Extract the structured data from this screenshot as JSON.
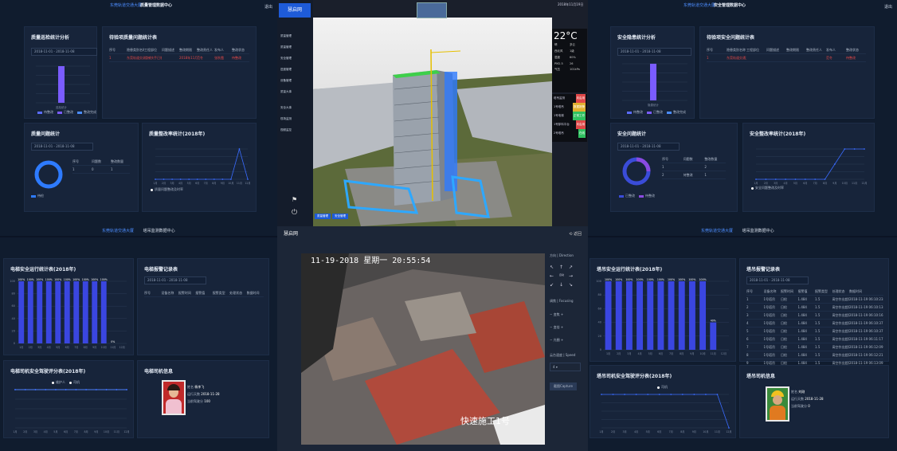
{
  "q1": {
    "t1": "东莞轨道交通大厦",
    "t2": "质量管理数据中心",
    "exit": "退出",
    "p1": {
      "title": "质量巡检统计分析",
      "date_from": "2018-11-01",
      "date_to": "2018-11-08",
      "legend": [
        "待整改",
        "已整改",
        "整改完成"
      ]
    },
    "p2": {
      "title": "待验项质量问题统计表",
      "headers": [
        "序号",
        "隐患类别名称",
        "工程部位",
        "问题描述",
        "整改期限",
        "整改责任人",
        "发布人",
        "整改状态"
      ],
      "row": [
        "1",
        "东莞轨道交通大厦",
        "楼梯扶手已装1/1",
        "",
        "2018年11月8日",
        "范冬",
        "张秋霞",
        "待整改"
      ]
    },
    "p3": {
      "title": "质量问题统计",
      "date_from": "2018-11-01",
      "date_to": "2018-11-08",
      "headers": [
        "序号",
        "问题数",
        "整改数量"
      ],
      "row": [
        "1",
        "0",
        "1"
      ],
      "legend": "待检"
    },
    "p4": {
      "title": "质量整改率统计(2018年)",
      "legend": "质量问题整改及时率"
    },
    "nav_a": "东莞轨道交通大厦",
    "nav_b": "塔吊监测数据中心"
  },
  "q2": {
    "t1": "东莞轨道交通大厦",
    "t2": "安全管理数据中心",
    "exit": "退出",
    "p1": {
      "title": "安全隐患统计分析",
      "date_from": "2018-11-01",
      "date_to": "2018-11-08",
      "legend": [
        "待整改",
        "已整改",
        "整改完成"
      ]
    },
    "p2": {
      "title": "待验项安全问题统计表",
      "headers": [
        "序号",
        "隐患类别名称",
        "工程部位",
        "问题描述",
        "整改期限",
        "整改责任人",
        "发布人",
        "整改状态"
      ],
      "row": [
        "1",
        "东莞轨道交通大厦",
        "",
        "",
        "",
        "",
        "范冬",
        "待整改"
      ]
    },
    "p3": {
      "title": "安全问题统计",
      "date_from": "2018-11-01",
      "date_to": "2018-11-08",
      "headers": [
        "序号",
        "问题数",
        "整改数量"
      ],
      "rows": [
        [
          "1",
          "",
          "2"
        ],
        [
          "2",
          "待整改",
          "1"
        ]
      ],
      "legend": [
        "已整改",
        "待整改"
      ]
    },
    "p4": {
      "title": "安全整改率统计(2018年)",
      "legend": "安全问题整改及时率"
    },
    "nav_a": "东莞轨道交通大厦",
    "nav_b": "塔吊监测数据中心"
  },
  "center": {
    "logo": "慧启网",
    "date_label": "2018年11月19日",
    "menu": [
      "质量管理",
      "质量管理",
      "安全管理",
      "进度管理",
      "设备管理",
      "质量大事",
      "安全大事",
      "现场监测",
      "视频监控"
    ],
    "weather": {
      "temp": "22°C",
      "items": [
        "晴",
        "多云",
        "西北风",
        "1级",
        "湿度",
        "60%",
        "PM2.5",
        "26",
        "气压",
        "101kPa"
      ]
    },
    "status": [
      {
        "label": "塔吊监测",
        "value": "未启用",
        "color": "#e04848"
      },
      {
        "label": "1号塔吊",
        "value": "数据报警",
        "color": "#e0b030"
      },
      {
        "label": "1号电梯",
        "value": "正常工作",
        "color": "#30c060"
      },
      {
        "label": "1号卸料平台",
        "value": "未启用",
        "color": "#e04848"
      },
      {
        "label": "2号塔吊",
        "value": "在线",
        "color": "#30c060"
      }
    ],
    "bottom_tabs": [
      "质量管理",
      "安全管理"
    ]
  },
  "video": {
    "logo": "慧启网",
    "back": "返回",
    "timestamp": "11-19-2018 星期一 20:55:54",
    "caption": "快速施工1号",
    "direction": "方向 | Direction",
    "focusing": "调焦 | Focusing",
    "speed": "云台速度 | Speed",
    "speed_value": "4",
    "capture": "截图Capture",
    "zoom_labels": [
      "变焦",
      "变倍",
      "光圈"
    ]
  },
  "q3": {
    "p1": {
      "title": "电梯安全运行统计表(2018年)",
      "yticks": [
        "100",
        "80",
        "60",
        "40",
        "20",
        "0"
      ]
    },
    "p2": {
      "title": "电梯报警记录表",
      "date_from": "2018-11-01",
      "date_to": "2018-11-08",
      "headers": [
        "序号",
        "设备名称",
        "报警时间",
        "报警值",
        "报警类型",
        "处理状态",
        "数据时间"
      ]
    },
    "p3": {
      "title": "电梯司机安全驾驶评分表(2018年)",
      "legend": [
        "维护人",
        "司机"
      ]
    },
    "p4": {
      "title": "电梯司机信息",
      "name_label": "姓名",
      "name": "杨李飞",
      "work_label": "运行天数",
      "work": "2018-11-28",
      "score_label": "当前驾驶分",
      "score": "100"
    }
  },
  "q4": {
    "p1": {
      "title": "塔吊安全运行统计表(2018年)"
    },
    "p2": {
      "title": "塔吊报警记录表",
      "date_from": "2018-11-01",
      "date_to": "2018-11-08",
      "headers": [
        "序号",
        "设备名称",
        "报警时间",
        "报警值",
        "报警类型",
        "处理状态",
        "数据时间"
      ],
      "rows": [
        [
          "1",
          "1号塔吊",
          "日检",
          "1.484",
          "1.5",
          "高空作业超限",
          "2018-11-19 06:10:23"
        ],
        [
          "2",
          "1号塔吊",
          "日检",
          "1.484",
          "1.5",
          "高空作业超限",
          "2018-11-19 06:10:13"
        ],
        [
          "3",
          "1号塔吊",
          "日检",
          "1.484",
          "1.5",
          "高空作业超限",
          "2018-11-19 06:10:16"
        ],
        [
          "4",
          "1号塔吊",
          "日检",
          "1.484",
          "1.5",
          "高空作业超限",
          "2018-11-19 06:10:37"
        ],
        [
          "5",
          "1号塔吊",
          "日检",
          "1.484",
          "1.5",
          "高空作业超限",
          "2018-11-19 06:10:37"
        ],
        [
          "6",
          "1号塔吊",
          "日检",
          "1.484",
          "1.5",
          "高空作业超限",
          "2018-11-19 06:11:17"
        ],
        [
          "7",
          "1号塔吊",
          "日检",
          "1.484",
          "1.5",
          "高空作业超限",
          "2018-11-19 06:12:09"
        ],
        [
          "8",
          "1号塔吊",
          "日检",
          "1.484",
          "1.5",
          "高空作业超限",
          "2018-11-19 06:12:21"
        ],
        [
          "9",
          "1号塔吊",
          "日检",
          "1.484",
          "1.5",
          "高空作业超限",
          "2018-11-19 06:13:09"
        ]
      ]
    },
    "p3": {
      "title": "塔吊司机安全驾驶评分表(2018年)",
      "legend": "司机"
    },
    "p4": {
      "title": "塔吊司机信息",
      "name_label": "姓名",
      "name": "刘刚",
      "work_label": "运行天数",
      "work": "2018-11-28",
      "score_label": "当前驾驶分",
      "score": "0"
    }
  },
  "chart_data": [
    {
      "type": "bar",
      "title": "质量巡检统计分析",
      "categories": [
        "巡检统计"
      ],
      "series": [
        {
          "name": "待整改",
          "values": [
            0
          ]
        },
        {
          "name": "已整改",
          "values": [
            1
          ]
        },
        {
          "name": "整改完成",
          "values": [
            0
          ]
        }
      ],
      "ylim": [
        0,
        1
      ]
    },
    {
      "type": "line",
      "title": "质量整改率统计(2018年)",
      "categories": [
        "1月",
        "2月",
        "3月",
        "4月",
        "5月",
        "6月",
        "7月",
        "8月",
        "9月",
        "10月",
        "11月",
        "12月"
      ],
      "series": [
        {
          "name": "质量问题整改及时率",
          "values": [
            0,
            0,
            0,
            0,
            0,
            0,
            0,
            0,
            0,
            0,
            1,
            0
          ]
        }
      ]
    },
    {
      "type": "bar",
      "title": "安全隐患统计分析",
      "categories": [
        "隐患统计"
      ],
      "series": [
        {
          "name": "待整改",
          "values": [
            0
          ]
        },
        {
          "name": "已整改",
          "values": [
            1
          ]
        },
        {
          "name": "整改完成",
          "values": [
            0
          ]
        }
      ],
      "ylim": [
        0,
        1
      ]
    },
    {
      "type": "line",
      "title": "安全整改率统计(2018年)",
      "categories": [
        "1月",
        "2月",
        "3月",
        "4月",
        "5月",
        "6月",
        "7月",
        "8月",
        "9月",
        "10月",
        "11月",
        "12月"
      ],
      "series": [
        {
          "name": "安全问题整改及时率",
          "values": [
            0,
            0,
            0,
            0,
            0,
            0,
            0,
            0,
            0.5,
            1,
            1,
            1
          ]
        }
      ]
    },
    {
      "type": "bar",
      "title": "电梯安全运行统计表(2018年)",
      "categories": [
        "1月",
        "2月",
        "3月",
        "4月",
        "5月",
        "6月",
        "7月",
        "8月",
        "9月",
        "10月",
        "11月",
        "12月"
      ],
      "values": [
        100,
        100,
        100,
        100,
        100,
        100,
        100,
        100,
        100,
        100,
        0,
        0
      ],
      "labels": [
        "100%",
        "100%",
        "100%",
        "100%",
        "100%",
        "100%",
        "100%",
        "100%",
        "100%",
        "100%",
        "0%",
        ""
      ],
      "ylim": [
        0,
        100
      ]
    },
    {
      "type": "line",
      "title": "电梯司机安全驾驶评分表(2018年)",
      "categories": [
        "1月",
        "2月",
        "3月",
        "4月",
        "5月",
        "6月",
        "7月",
        "8月",
        "9月",
        "10月",
        "11月",
        "12月"
      ],
      "series": [
        {
          "name": "维护人",
          "values": [
            100,
            100,
            100,
            100,
            100,
            100,
            100,
            100,
            100,
            100,
            100,
            100
          ]
        },
        {
          "name": "司机",
          "values": [
            100,
            100,
            100,
            100,
            100,
            100,
            100,
            100,
            100,
            100,
            100,
            100
          ]
        }
      ],
      "ylim": [
        0,
        100
      ]
    },
    {
      "type": "bar",
      "title": "塔吊安全运行统计表(2018年)",
      "categories": [
        "1月",
        "2月",
        "3月",
        "4月",
        "5月",
        "6月",
        "7月",
        "8月",
        "9月",
        "10月",
        "11月",
        "12月"
      ],
      "values": [
        100,
        100,
        100,
        100,
        100,
        100,
        100,
        100,
        100,
        100,
        40,
        0
      ],
      "labels": [
        "100%",
        "100%",
        "100%",
        "100%",
        "100%",
        "100%",
        "100%",
        "100%",
        "100%",
        "100%",
        "40%",
        ""
      ],
      "ylim": [
        0,
        100
      ]
    },
    {
      "type": "line",
      "title": "塔吊司机安全驾驶评分表(2018年)",
      "categories": [
        "1月",
        "2月",
        "3月",
        "4月",
        "5月",
        "6月",
        "7月",
        "8月",
        "9月",
        "10月",
        "11月",
        "12月"
      ],
      "series": [
        {
          "name": "司机",
          "values": [
            100,
            100,
            100,
            100,
            100,
            100,
            100,
            100,
            100,
            100,
            100,
            0
          ]
        }
      ],
      "ylim": [
        0,
        100
      ]
    }
  ]
}
